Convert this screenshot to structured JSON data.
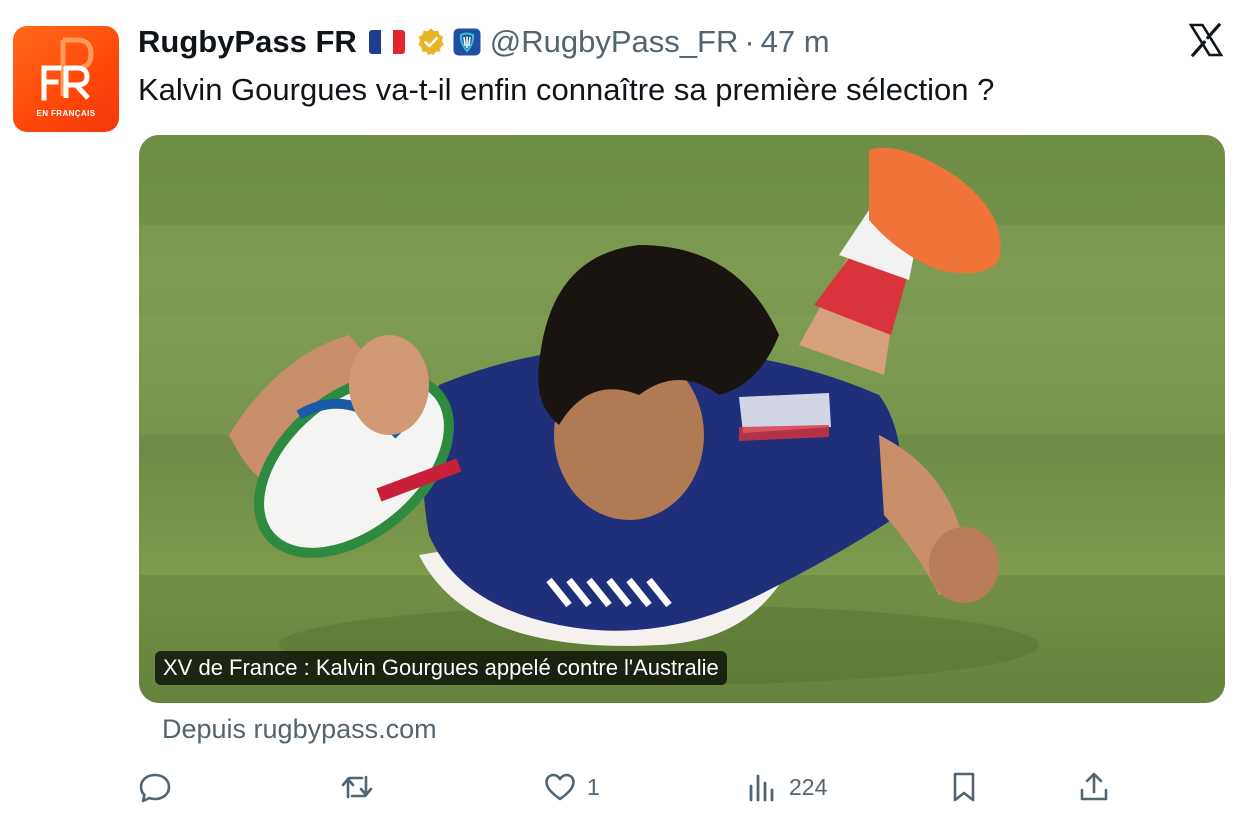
{
  "author": {
    "display_name": "RugbyPass FR",
    "handle": "@RugbyPass_FR",
    "separator": "·",
    "time_ago": "47 m",
    "flag_icon": "france-flag-icon",
    "verified_icon": "verified-badge-icon",
    "affiliate_icon": "affiliate-badge-icon",
    "avatar": {
      "logo_letters": "FR",
      "tagline": "EN FRANÇAIS",
      "bg_color": "#ff5a12"
    }
  },
  "tweet": {
    "text": "Kalvin Gourgues va-t-il enfin connaître sa première sélection ?"
  },
  "card": {
    "image_description_icon": "rugby-player-diving-try-image",
    "caption": "XV de France : Kalvin Gourgues appelé contre l'Australie",
    "source": "Depuis rugbypass.com"
  },
  "actions": {
    "reply": {
      "icon": "reply-icon",
      "count": ""
    },
    "retweet": {
      "icon": "retweet-icon",
      "count": ""
    },
    "like": {
      "icon": "heart-icon",
      "count": "1"
    },
    "views": {
      "icon": "views-icon",
      "count": "224"
    },
    "bookmark": {
      "icon": "bookmark-icon",
      "count": ""
    },
    "share": {
      "icon": "share-icon",
      "count": ""
    }
  },
  "platform": {
    "logo_icon": "x-logo-icon"
  },
  "colors": {
    "text_primary": "#0f1419",
    "text_secondary": "#536471",
    "verified_gold": "#e8b324",
    "affiliate_blue": "#1f4fa0",
    "grass": "#7a974f"
  }
}
